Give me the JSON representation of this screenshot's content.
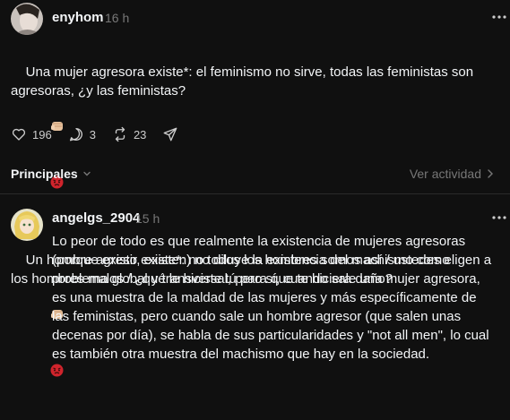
{
  "post": {
    "username": "enyhom",
    "time": "16 h",
    "paragraph1": "Una mujer agresora existe*: el feminismo no sirve, todas las feministas son agresoras, ¿y las feministas?",
    "paragraph2": "Un hombre agreso existe*: no todos los hombres somos así / ustedes eligen a los hombres malos / ¿qué le hiciste tú para que te hiciera daño?",
    "emojis": [
      "fist-emoji",
      "angry-face-emoji"
    ],
    "likes": "196",
    "comments": "3",
    "reposts": "23"
  },
  "sort": {
    "left_label": "Principales",
    "right_label": "Ver actividad"
  },
  "reply": {
    "username": "angelgs_2904",
    "time": "15 h",
    "text": "Lo peor de todo es que realmente la existencia de mujeres agresoras (porque existir, existen) no diluye la existencia del machismo como problema global y transversal, pero sí, cuando sale una mujer agresora, es una muestra de la maldad de las mujeres y más específicamente de las feministas, pero cuando sale un hombre agresor (que salen unas decenas por día), se habla de sus particularidades y \"not all men\", lo cual es también otra muestra del machismo que hay en la sociedad."
  },
  "colors": {
    "background": "#101010",
    "text": "#f3f5f7",
    "muted": "#777777",
    "emoji_red": "#d0242c"
  }
}
